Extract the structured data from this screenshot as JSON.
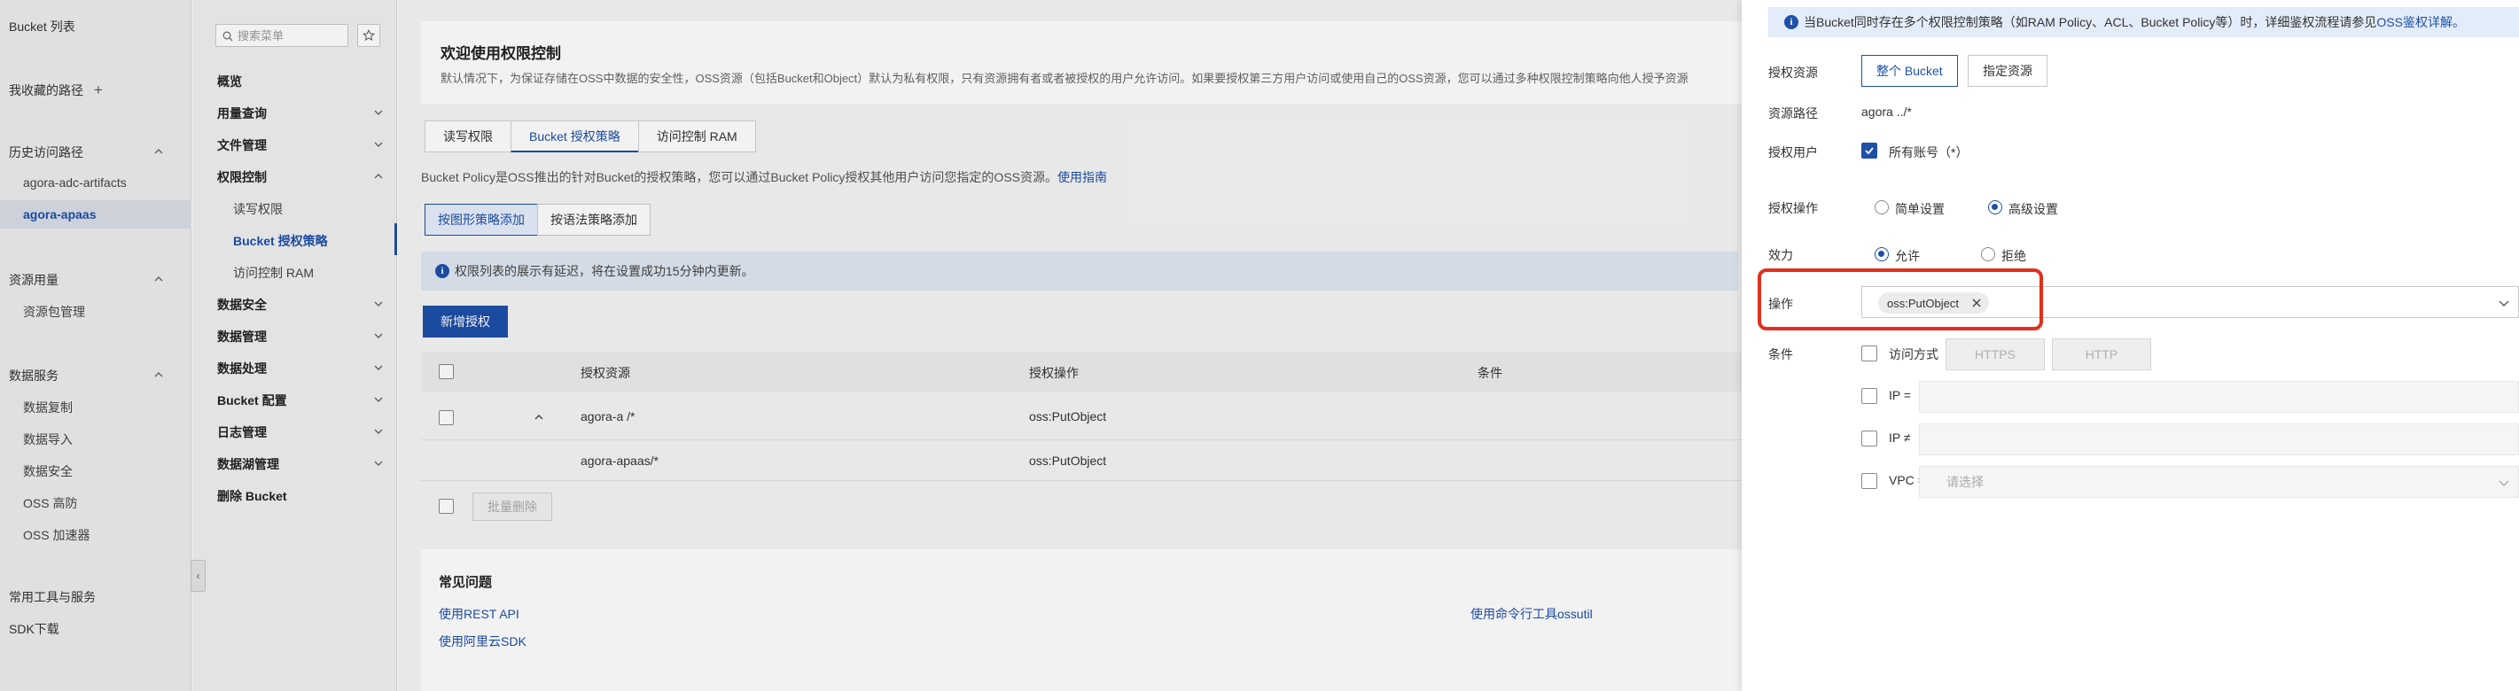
{
  "left_nav": {
    "bucket_list": "Bucket 列表",
    "favorites": "我收藏的路径",
    "history": "历史访问路径",
    "history_items": [
      "agora-adc-artifacts",
      "agora-apaas"
    ],
    "resource_group": "资源用量",
    "resource_items": [
      "资源包管理"
    ],
    "data_services": "数据服务",
    "data_service_items": [
      "数据复制",
      "数据导入",
      "数据安全",
      "OSS 高防",
      "OSS 加速器"
    ],
    "tools": "常用工具与服务",
    "sdk": "SDK下载"
  },
  "mid_nav": {
    "search_placeholder": "搜索菜单",
    "items": [
      {
        "label": "概览"
      },
      {
        "label": "用量查询"
      },
      {
        "label": "文件管理"
      },
      {
        "label": "权限控制"
      },
      {
        "label": "读写权限"
      },
      {
        "label": "Bucket 授权策略"
      },
      {
        "label": "访问控制 RAM"
      },
      {
        "label": "数据安全"
      },
      {
        "label": "数据管理"
      },
      {
        "label": "数据处理"
      },
      {
        "label": "Bucket 配置"
      },
      {
        "label": "日志管理"
      },
      {
        "label": "数据湖管理"
      },
      {
        "label": "删除 Bucket"
      }
    ]
  },
  "main": {
    "welcome_title": "欢迎使用权限控制",
    "welcome_desc": "默认情况下，为保证存储在OSS中数据的安全性，OSS资源（包括Bucket和Object）默认为私有权限，只有资源拥有者或者被授权的用户允许访问。如果要授权第三方用户访问或使用自己的OSS资源，您可以通过多种权限控制策略向他人授予资源",
    "tabs": [
      "读写权限",
      "Bucket 授权策略",
      "访问控制 RAM"
    ],
    "policy_note": "Bucket Policy是OSS推出的针对Bucket的授权策略，您可以通过Bucket Policy授权其他用户访问您指定的OSS资源。",
    "policy_link": "使用指南",
    "mode_tabs": [
      "按图形策略添加",
      "按语法策略添加"
    ],
    "info_text": "权限列表的展示有延迟，将在设置成功15分钟内更新。",
    "add_button": "新增授权",
    "table": {
      "headers": [
        "授权资源",
        "授权操作",
        "条件"
      ],
      "rows": [
        {
          "resource": "agora-a      /*",
          "action": "oss:PutObject"
        },
        {
          "resource": "agora-apaas/*",
          "action": "oss:PutObject"
        }
      ],
      "batch_delete": "批量删除"
    },
    "faq": {
      "title": "常见问题",
      "links": [
        "使用REST API",
        "使用阿里云SDK",
        "使用命令行工具ossutil"
      ]
    }
  },
  "drawer": {
    "notice": "当Bucket同时存在多个权限控制策略（如RAM Policy、ACL、Bucket Policy等）时，详细鉴权流程请参见",
    "notice_link": "OSS鉴权详解。",
    "resource_label": "授权资源",
    "resource_options": [
      "整个 Bucket",
      "指定资源"
    ],
    "path_label": "资源路径",
    "path_value": "agora        ../*",
    "user_label": "授权用户",
    "user_value": "所有账号（*）",
    "op_label": "授权操作",
    "op_options": [
      "简单设置",
      "高级设置"
    ],
    "effect_label": "效力",
    "effect_options": [
      "允许",
      "拒绝"
    ],
    "action_label": "操作",
    "action_tag": "oss:PutObject",
    "cond_label": "条件",
    "cond_access": "访问方式",
    "cond_access_opts": [
      "HTTPS",
      "HTTP"
    ],
    "cond_ip_eq": "IP =",
    "cond_ip_ne": "IP ≠",
    "cond_vpc": "VPC =",
    "vpc_placeholder": "请选择"
  },
  "colors": {
    "accent": "#1d50a8",
    "highlight": "#e0301e"
  }
}
